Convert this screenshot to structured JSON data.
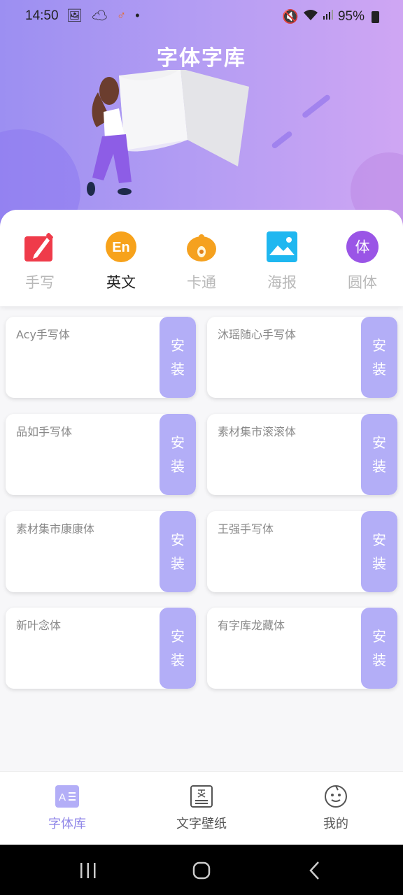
{
  "status_bar": {
    "time": "14:50",
    "left_icons": [
      "gallery-icon",
      "cloud-icon",
      "gender-app-icon",
      "dot-icon"
    ],
    "battery": "95%",
    "right_icons": [
      "mute-icon",
      "wifi-icon",
      "signal-icon",
      "battery-icon"
    ]
  },
  "header": {
    "title": "字体字库"
  },
  "categories": [
    {
      "label": "手写",
      "icon": "pencil-icon",
      "color": "#ef3b4a",
      "active": false
    },
    {
      "label": "英文",
      "icon": "en-icon",
      "icon_text": "En",
      "color": "#f7a21b",
      "active": true
    },
    {
      "label": "卡通",
      "icon": "cartoon-icon",
      "color": "#f5a11f",
      "active": false
    },
    {
      "label": "海报",
      "icon": "image-icon",
      "color": "#1fb7f0",
      "active": false
    },
    {
      "label": "圆体",
      "icon": "round-font-icon",
      "icon_text": "体",
      "color": "#9a55e6",
      "active": false
    }
  ],
  "fonts": [
    {
      "name": "Acy手写体",
      "button": [
        "安",
        "装"
      ]
    },
    {
      "name": "沐瑶随心手写体",
      "button": [
        "安",
        "装"
      ]
    },
    {
      "name": "品如手写体",
      "button": [
        "安",
        "装"
      ]
    },
    {
      "name": "素材集市滚滚体",
      "button": [
        "安",
        "装"
      ]
    },
    {
      "name": "素材集市康康体",
      "button": [
        "安",
        "装"
      ]
    },
    {
      "name": "王强手写体",
      "button": [
        "安",
        "装"
      ]
    },
    {
      "name": "新叶念体",
      "button": [
        "安",
        "装"
      ]
    },
    {
      "name": "有字库龙藏体",
      "button": [
        "安",
        "装"
      ]
    }
  ],
  "tabs": [
    {
      "label": "字体库",
      "icon": "font-library-icon",
      "active": true
    },
    {
      "label": "文字壁纸",
      "icon": "text-wallpaper-icon",
      "active": false
    },
    {
      "label": "我的",
      "icon": "profile-face-icon",
      "active": false
    }
  ],
  "colors": {
    "accent": "#b3aef7",
    "active_tab": "#8f86e8"
  }
}
